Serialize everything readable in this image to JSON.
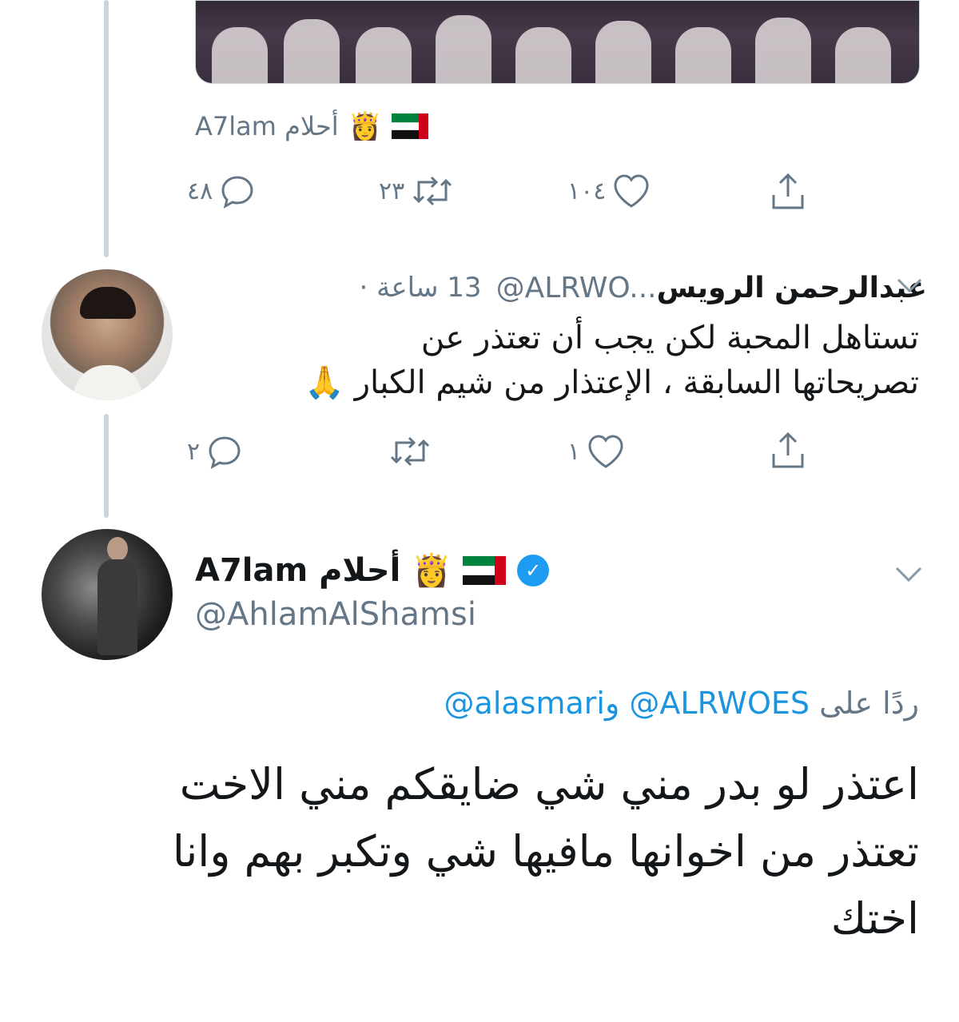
{
  "tweet1": {
    "author_display": "A7lam أحلام",
    "actions": {
      "replies": "٤٨",
      "retweets": "٢٣",
      "likes": "١٠٤"
    }
  },
  "reply1": {
    "display_name": "عبدالرحمن الرويس",
    "handle": "@ALRWO...",
    "time": "13 ساعة ·",
    "text_line1": "تستاهل المحبة لكن يجب أن تعتذر عن",
    "text_line2": "تصريحاتها السابقة ، الإعتذار من شيم الكبار 🙏",
    "actions": {
      "replies": "٢",
      "retweets": "",
      "likes": "١"
    }
  },
  "tweet2": {
    "display_name": "A7lam أحلام",
    "handle": "@AhlamAlShamsi",
    "reply_prefix": "ردًا على",
    "reply_to1": "@ALRWOES",
    "reply_and": "و",
    "reply_to2": "@alasmari",
    "text_line1": "اعتذر لو بدر مني شي ضايقكم مني الاخت",
    "text_line2": "تعتذر من اخوانها مافيها شي وتكبر بهم وانا",
    "text_line3": "اختك"
  },
  "colors": {
    "muted": "#657786",
    "link": "#1b95e0",
    "verified": "#1d9bf0",
    "line": "#ccd6dd"
  },
  "icons": [
    "reply-icon",
    "retweet-icon",
    "like-icon",
    "share-icon",
    "chevron-down-icon",
    "verified-icon",
    "uae-flag-icon",
    "crown-woman-icon"
  ]
}
